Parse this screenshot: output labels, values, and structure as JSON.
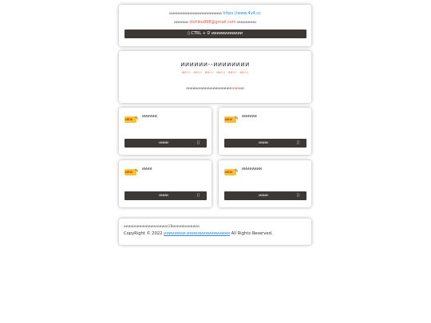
{
  "notice_bar": {
    "prefix": "ииииииииииииииииииииии",
    "url": "https://www.4v4.cc",
    "line2_prefix": "ииииии",
    "email": "dizhiku998@gmail.com",
    "line2_suffix": "ииииииии",
    "shortcut_label": "▯ CTRL + D ииииииииииии"
  },
  "header": {
    "site_title": "ииииии--ииииииии",
    "tags": [
      "ии",
      "ии",
      "ии",
      "ии",
      "ии",
      "ии",
      "ии",
      "ии",
      "ии",
      "ии",
      "ии",
      "ии"
    ],
    "notice_text": "ииииииииииииииииииии",
    "notice_highlight": "ииии",
    "notice_end": "ии"
  },
  "tiles": [
    {
      "badge": "NEW",
      "name": "ииииии",
      "button": "ииии",
      "button_icon": "▯"
    },
    {
      "badge": "NEW",
      "name": "ииииии",
      "button": "ииии",
      "button_icon": "▯"
    },
    {
      "badge": "NEW",
      "name": "ииии",
      "button": "ииии",
      "button_icon": "▯"
    },
    {
      "badge": "NEW",
      "name": "ииииииии",
      "button": "ииии",
      "button_icon": "▯"
    }
  ],
  "footer": {
    "age_notice": "ииииииииииииииииииии18ииииииииииии",
    "copyright_prefix": "CopyRight © 2022",
    "link_text": "ииииииии-ииииииииииииииии",
    "rights": "All Rights Reserved."
  },
  "colors": {
    "dark_button": "#3c3835",
    "link_blue": "#2a8bd8",
    "accent_red": "#e0533a",
    "tag_pink": "#e8766a",
    "badge_yellow": "#f7c233"
  }
}
